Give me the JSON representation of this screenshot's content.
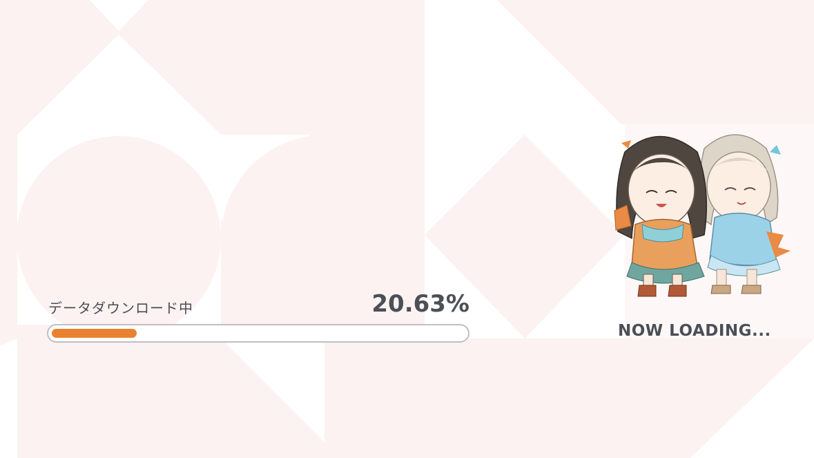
{
  "loader": {
    "status_label": "データダウンロード中",
    "percent_text": "20.63%",
    "progress_fraction": 0.2063,
    "fill_color": "#ea8130",
    "now_loading": "NOW LOADING..."
  },
  "decor": {
    "mascot_icon": "two-chibi-characters-icon",
    "background_tint": "#fcf2f1"
  }
}
